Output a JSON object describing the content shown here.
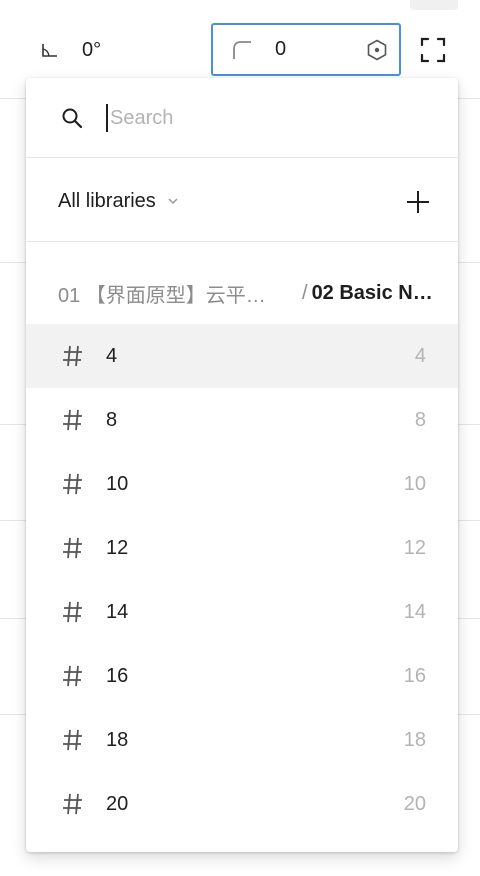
{
  "properties": {
    "rotation_value": "0°",
    "corner_radius_value": "0"
  },
  "popover": {
    "search": {
      "placeholder": "Search",
      "value": ""
    },
    "library_select": {
      "selected": "All libraries"
    },
    "breadcrumb": {
      "parent": "01 【界面原型】云平…",
      "separator": "/",
      "current": "02 Basic N…"
    },
    "variables": [
      {
        "name": "4",
        "value": "4",
        "active": true
      },
      {
        "name": "8",
        "value": "8"
      },
      {
        "name": "10",
        "value": "10"
      },
      {
        "name": "12",
        "value": "12"
      },
      {
        "name": "14",
        "value": "14"
      },
      {
        "name": "16",
        "value": "16"
      },
      {
        "name": "18",
        "value": "18"
      },
      {
        "name": "20",
        "value": "20"
      }
    ]
  },
  "colors": {
    "focus_border": "#4a90e2",
    "active_row": "#f2f2f2",
    "muted_text": "#b3b3b3"
  },
  "icons": [
    "rotation-icon",
    "corner-radius-icon",
    "variable-hex-icon",
    "expand-corners-icon",
    "search-icon",
    "chevron-down-icon",
    "plus-icon",
    "hash-icon"
  ]
}
